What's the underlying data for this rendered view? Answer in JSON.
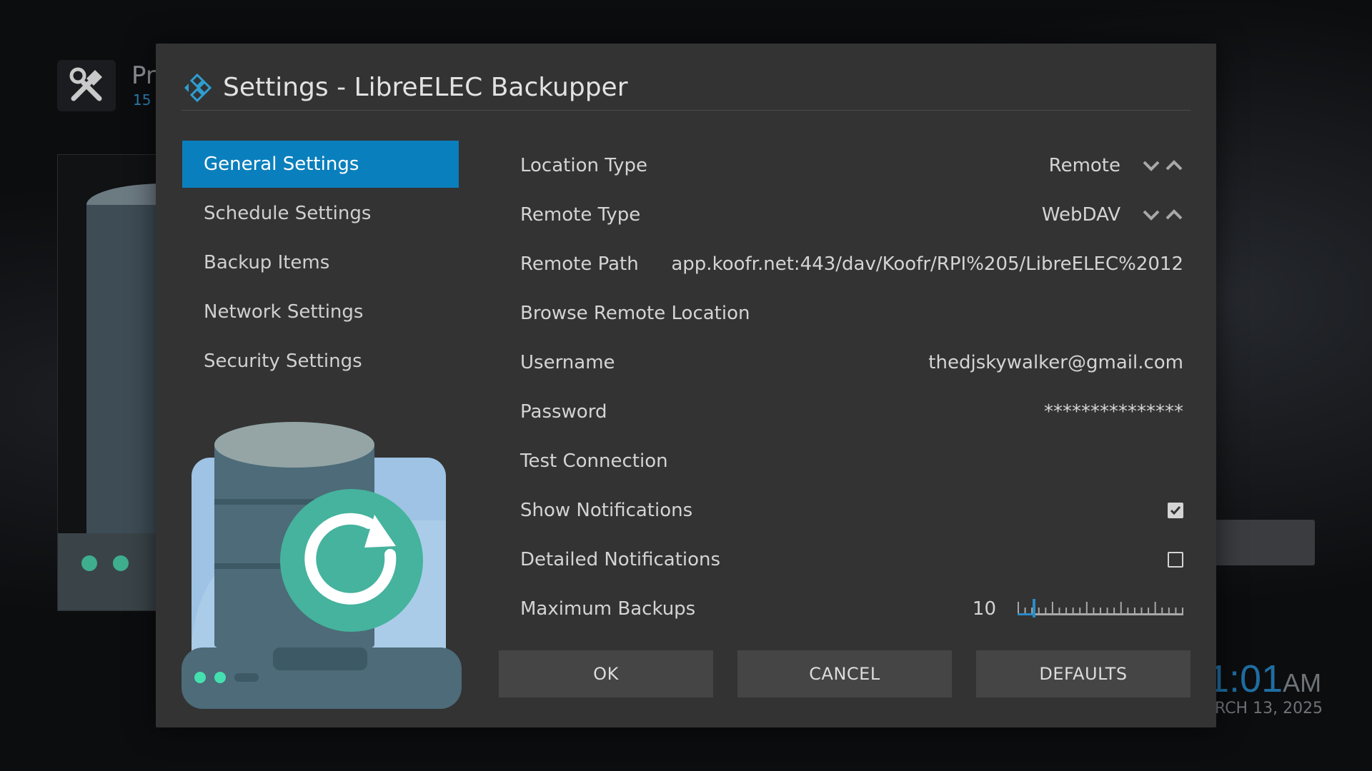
{
  "background": {
    "addon_title_fragment": "Pr",
    "addon_sub_fragment": "15",
    "clock_time": "1:01",
    "clock_ampm": "AM",
    "clock_date": "RCH 13, 2025"
  },
  "dialog": {
    "title": "Settings - LibreELEC Backupper",
    "categories": [
      {
        "label": "General Settings",
        "active": true
      },
      {
        "label": "Schedule Settings",
        "active": false
      },
      {
        "label": "Backup Items",
        "active": false
      },
      {
        "label": "Network Settings",
        "active": false
      },
      {
        "label": "Security Settings",
        "active": false
      }
    ],
    "settings": {
      "location_type": {
        "label": "Location Type",
        "value": "Remote"
      },
      "remote_type": {
        "label": "Remote Type",
        "value": "WebDAV"
      },
      "remote_path": {
        "label": "Remote Path",
        "value": "app.koofr.net:443/dav/Koofr/RPI%205/LibreELEC%2012"
      },
      "browse_remote": {
        "label": "Browse Remote Location"
      },
      "username": {
        "label": "Username",
        "value": "thedjskywalker@gmail.com"
      },
      "password": {
        "label": "Password",
        "value": "***************"
      },
      "test_connection": {
        "label": "Test Connection"
      },
      "show_notifications": {
        "label": "Show Notifications",
        "checked": true
      },
      "detailed_notifications": {
        "label": "Detailed Notifications",
        "checked": false
      },
      "maximum_backups": {
        "label": "Maximum Backups",
        "value": "10",
        "slider_fraction": 0.1
      }
    },
    "buttons": {
      "ok": "OK",
      "cancel": "CANCEL",
      "defaults": "DEFAULTS"
    }
  },
  "colors": {
    "accent": "#0a7fbd",
    "dialog_bg": "#333333",
    "button_bg": "#454545",
    "illustration_teal": "#45b39d"
  },
  "icons": {
    "header_logo": "kodi-diamond-icon",
    "addon_tile": "tools-icon",
    "spinner_down": "chevron-down-icon",
    "spinner_up": "chevron-up-icon",
    "illustration": "database-backup-icon"
  }
}
